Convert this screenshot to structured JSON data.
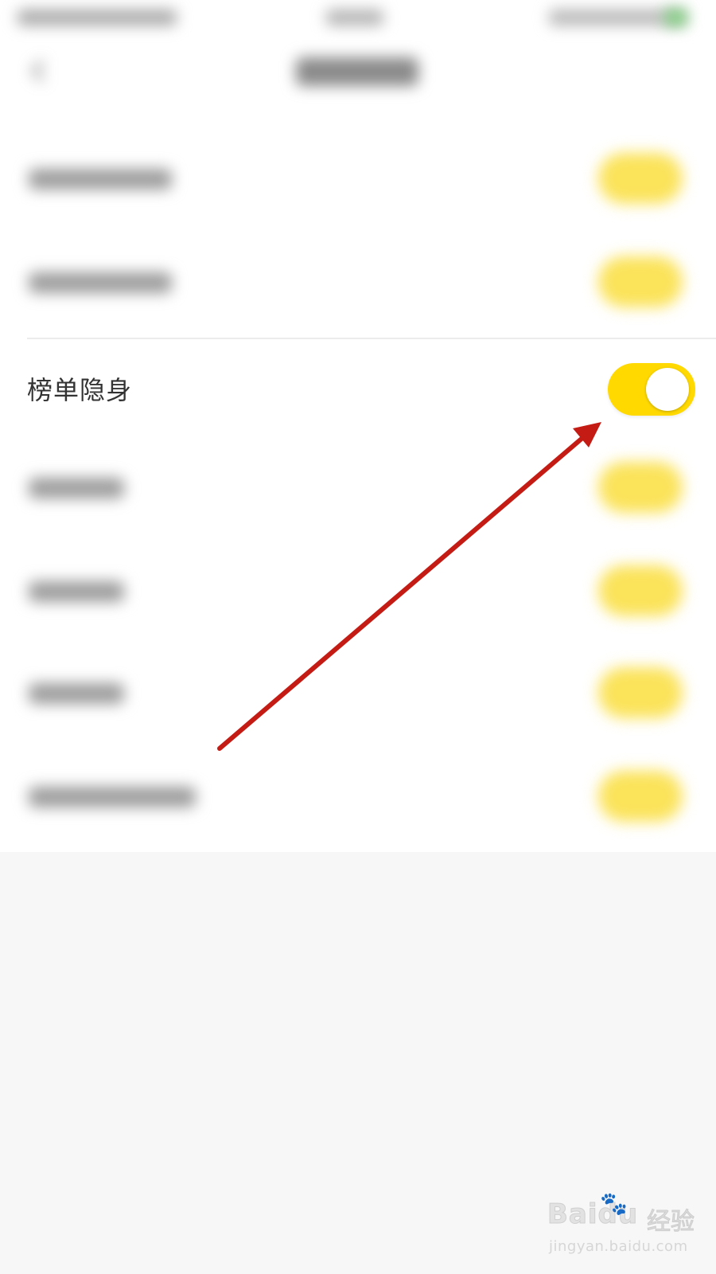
{
  "settings_row": {
    "label": "榜单隐身",
    "toggle_on": true
  },
  "colors": {
    "toggle_on": "#ffd900",
    "annotation_arrow": "#c41c14",
    "page_background": "#f7f7f7"
  },
  "icons": {
    "back": "chevron-left-icon",
    "annotation": "arrow-icon"
  },
  "watermark": {
    "logo_text": "Baidu",
    "brand_text": "经验",
    "url_text": "jingyan.baidu.com"
  }
}
